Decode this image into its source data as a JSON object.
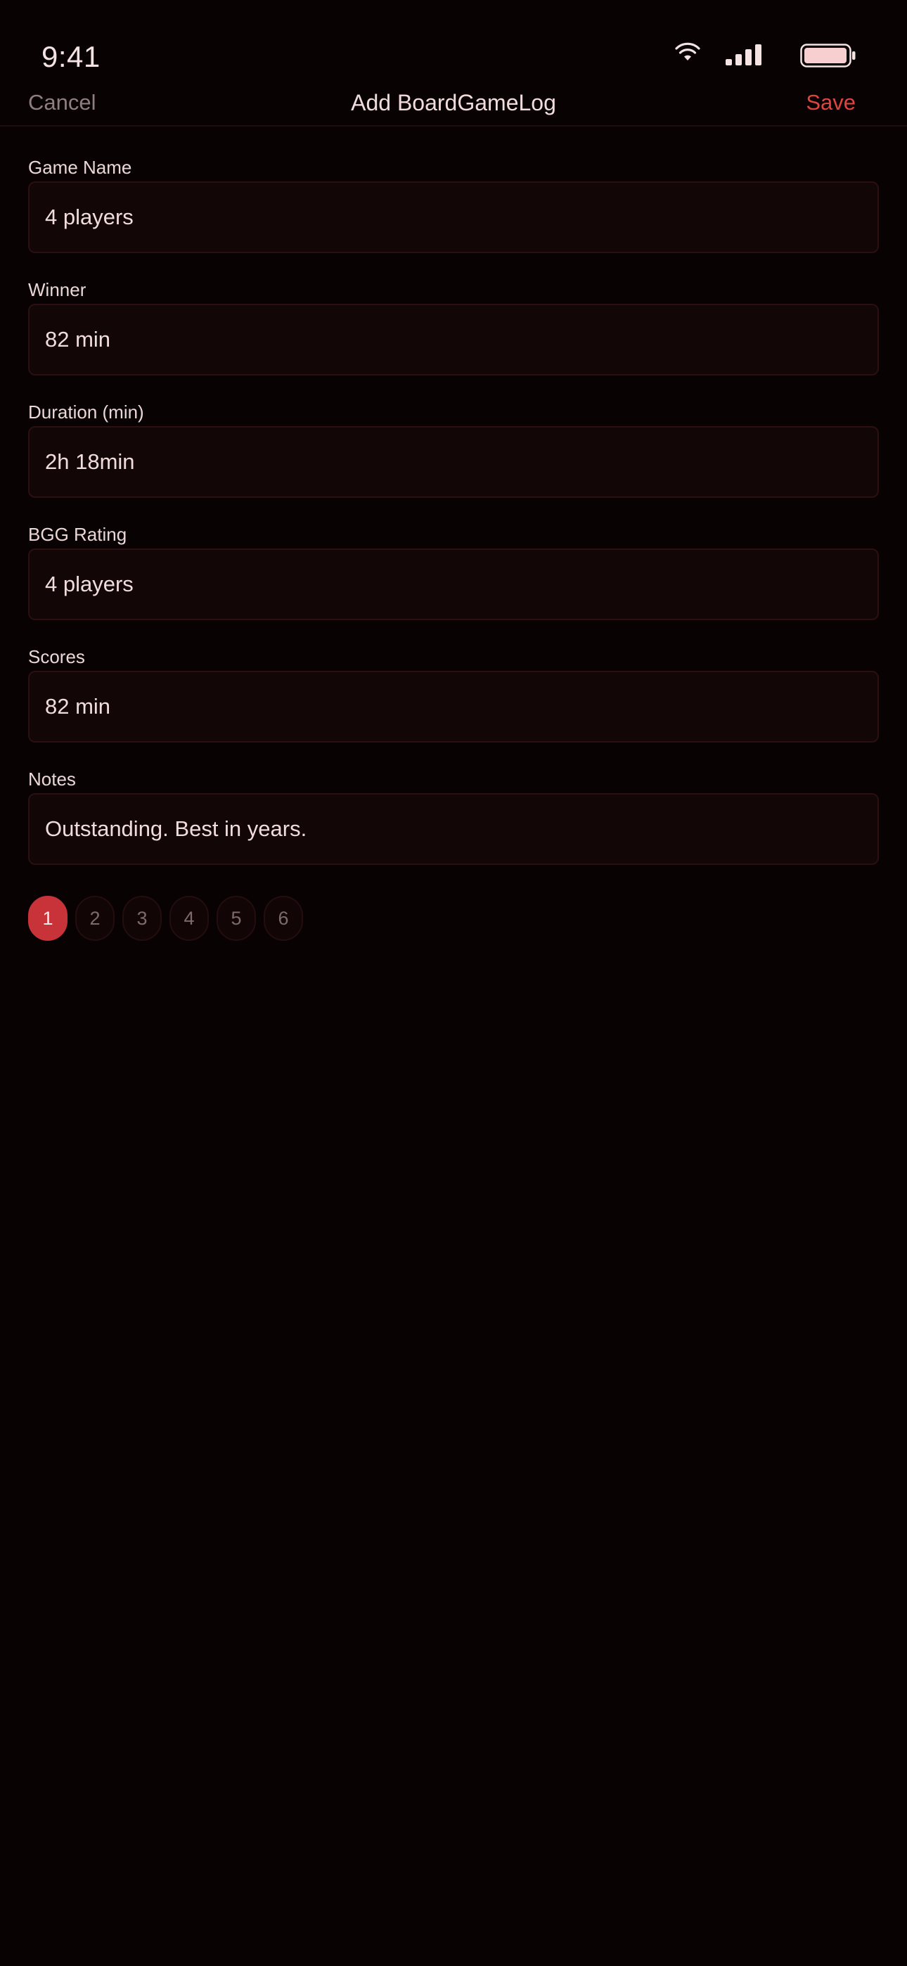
{
  "status_bar": {
    "time": "9:41",
    "icons": [
      "wifi-icon",
      "signal-icon",
      "battery-icon"
    ]
  },
  "nav": {
    "cancel_label": "Cancel",
    "title": "Add BoardGameLog",
    "save_label": "Save"
  },
  "form": {
    "fields": [
      {
        "label": "Game Name",
        "value": "4 players"
      },
      {
        "label": "Winner",
        "value": "82 min"
      },
      {
        "label": "Duration (min)",
        "value": "2h 18min"
      },
      {
        "label": "BGG Rating",
        "value": "4 players"
      },
      {
        "label": "Scores",
        "value": "82 min"
      },
      {
        "label": "Notes",
        "value": "Outstanding. Best in years."
      }
    ]
  },
  "pager": {
    "pages": [
      "1",
      "2",
      "3",
      "4",
      "5",
      "6"
    ],
    "active": "1"
  },
  "colors": {
    "background": "#090203",
    "accent": "#c8333a",
    "save_text": "#e0443f",
    "field_background": "#120607",
    "field_border": "#2b0f11"
  }
}
